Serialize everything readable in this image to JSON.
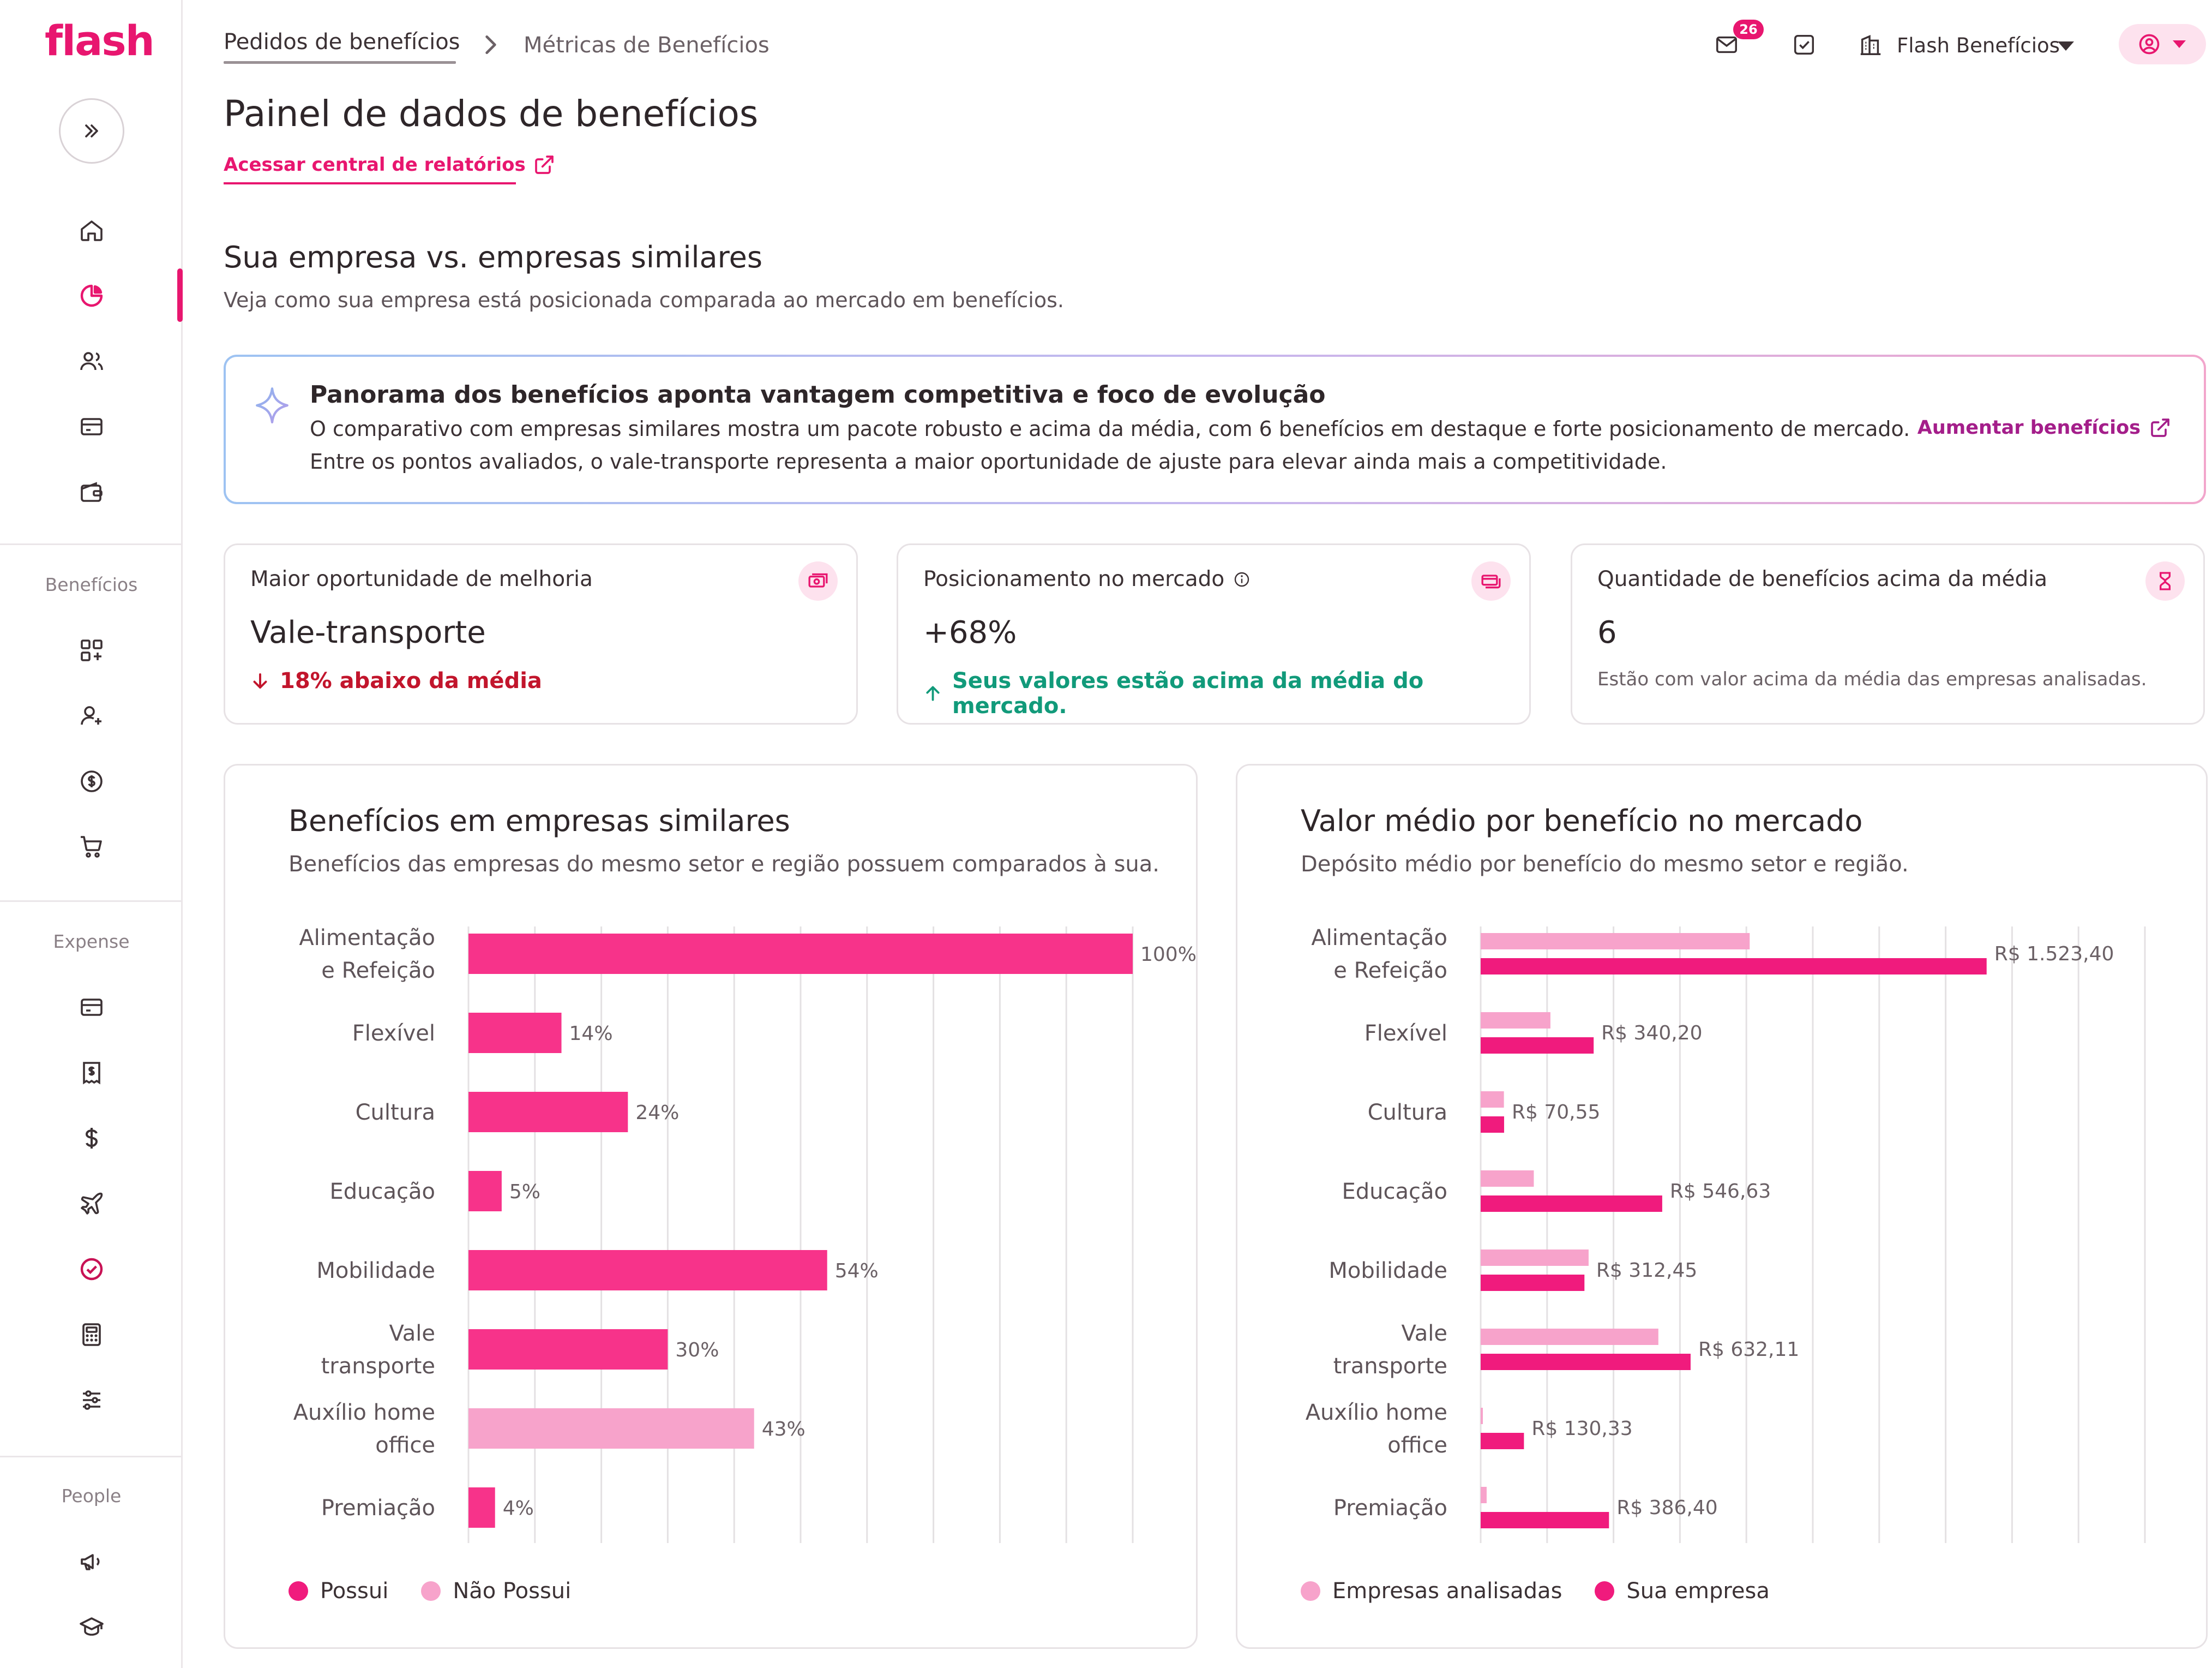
{
  "app": {
    "logo": "flash",
    "brand_color": "#e8166f"
  },
  "sidebar": {
    "sections": [
      "Benefícios",
      "Expense",
      "People"
    ],
    "top_icons": [
      "home-icon",
      "pie-chart-icon",
      "users-icon",
      "card-icon",
      "wallet-icon"
    ],
    "benefits_icons": [
      "apps-icon",
      "add-user-icon",
      "dollar-circle-icon",
      "cart-icon"
    ],
    "expense_icons": [
      "card-icon",
      "receipt-icon",
      "dollar-icon",
      "plane-icon",
      "check-circle-icon",
      "calculator-icon",
      "sliders-icon"
    ],
    "people_icons": [
      "megaphone-icon",
      "graduation-cap-icon"
    ]
  },
  "header": {
    "breadcrumb": [
      "Pedidos de benefícios",
      "Métricas de Benefícios"
    ],
    "notifications_count": "26",
    "company": "Flash Benefícios"
  },
  "page": {
    "title": "Painel de dados de benefícios",
    "report_link": "Acessar central de relatórios",
    "section_title": "Sua empresa vs. empresas similares",
    "section_subtitle": "Veja como sua empresa está posicionada comparada ao mercado em benefícios."
  },
  "insight": {
    "title": "Panorama dos benefícios aponta vantagem competitiva e foco de evolução",
    "line1": "O comparativo com empresas similares mostra um pacote robusto e acima da média, com 6 benefícios em destaque e forte posicionamento de mercado.",
    "line2": "Entre os pontos avaliados, o vale-transporte representa a maior oportunidade de ajuste para elevar ainda mais a competitividade.",
    "action": "Aumentar benefícios"
  },
  "kpis": [
    {
      "label": "Maior oportunidade de melhoria",
      "value": "Vale-transporte",
      "note": "18% abaixo da média",
      "tone": "negative",
      "icon": "money-icon"
    },
    {
      "label": "Posicionamento no mercado",
      "value": "+68%",
      "note": "Seus valores estão acima da média do mercado.",
      "tone": "positive",
      "icon": "money-cards-icon"
    },
    {
      "label": "Quantidade de benefícios acima da média",
      "value": "6",
      "note": "Estão com valor acima da média das empresas analisadas.",
      "tone": "neutral",
      "icon": "hourglass-icon"
    }
  ],
  "chart_data": [
    {
      "type": "bar",
      "orientation": "horizontal",
      "title": "Benefícios em empresas similares",
      "subtitle": "Benefícios das empresas do mesmo setor e região possuem comparados à sua.",
      "categories": [
        "Alimentação e Refeição",
        "Flexível",
        "Cultura",
        "Educação",
        "Mobilidade",
        "Vale transporte",
        "Auxílio home office",
        "Premiação"
      ],
      "category_lines": [
        [
          "Alimentação",
          "e Refeição"
        ],
        [
          "Flexível"
        ],
        [
          "Cultura"
        ],
        [
          "Educação"
        ],
        [
          "Mobilidade"
        ],
        [
          "Vale",
          "transporte"
        ],
        [
          "Auxílio home",
          "office"
        ],
        [
          "Premiação"
        ]
      ],
      "values": [
        100,
        14,
        24,
        5,
        54,
        30,
        43,
        4
      ],
      "value_labels": [
        "100%",
        "14%",
        "24%",
        "5%",
        "54%",
        "30%",
        "43%",
        "4%"
      ],
      "possui": [
        true,
        true,
        true,
        true,
        true,
        true,
        false,
        true
      ],
      "xlim": [
        0,
        100
      ],
      "grid": true,
      "legend": [
        "Possui",
        "Não Possui"
      ],
      "legend_position": "bottom-left",
      "colors": {
        "possui": "#f7338a",
        "nao_possui": "#f7a3cb"
      }
    },
    {
      "type": "bar",
      "orientation": "horizontal",
      "title": "Valor médio por benefício no mercado",
      "subtitle": "Depósito médio por benefício do mesmo setor e região.",
      "categories": [
        "Alimentação e Refeição",
        "Flexível",
        "Cultura",
        "Educação",
        "Mobilidade",
        "Vale transporte",
        "Auxílio home office",
        "Premiação"
      ],
      "category_lines": [
        [
          "Alimentação",
          "e Refeição"
        ],
        [
          "Flexível"
        ],
        [
          "Cultura"
        ],
        [
          "Educação"
        ],
        [
          "Mobilidade"
        ],
        [
          "Vale",
          "transporte"
        ],
        [
          "Auxílio home",
          "office"
        ],
        [
          "Premiação"
        ]
      ],
      "series": [
        {
          "name": "Empresas analisadas",
          "values": [
            810,
            210,
            70,
            160,
            325,
            535,
            6,
            18
          ]
        },
        {
          "name": "Sua empresa",
          "values": [
            1523.4,
            340.2,
            70.55,
            546.63,
            312.45,
            632.11,
            130.33,
            386.4
          ]
        }
      ],
      "value_labels": [
        "R$ 1.523,40",
        "R$ 340,20",
        "R$ 70,55",
        "R$ 546,63",
        "R$ 312,45",
        "R$ 632,11",
        "R$ 130,33",
        "R$ 386,40"
      ],
      "xlim": [
        0,
        2000
      ],
      "grid": true,
      "legend": [
        "Empresas analisadas",
        "Sua empresa"
      ],
      "legend_position": "bottom-left",
      "colors": {
        "market": "#f7a3cb",
        "company": "#f01b7d"
      }
    }
  ]
}
